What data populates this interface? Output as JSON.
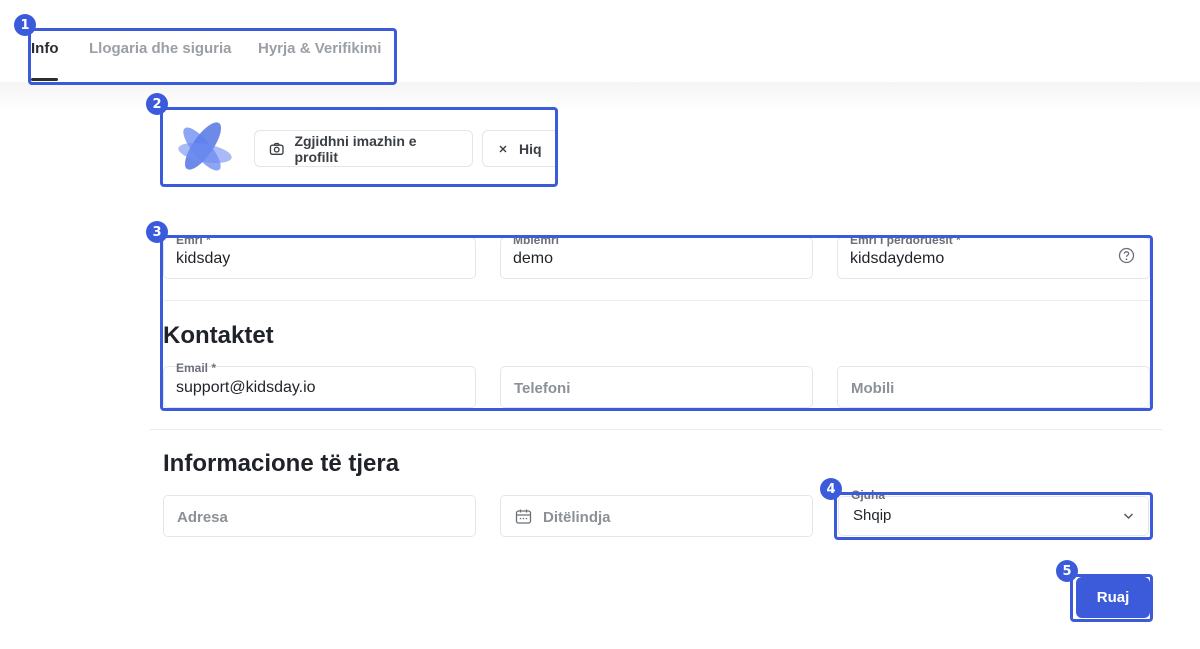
{
  "tabs": [
    {
      "label": "Info",
      "active": true
    },
    {
      "label": "Llogaria dhe siguria",
      "active": false
    },
    {
      "label": "Hyrja & Verifikimi",
      "active": false
    }
  ],
  "profile": {
    "choose_image_label": "Zgjidhni imazhin e profilit",
    "remove_label": "Hiq"
  },
  "personal": {
    "first_name": {
      "label": "Emri *",
      "value": "kidsday"
    },
    "last_name": {
      "label": "Mbiemri",
      "value": "demo"
    },
    "username": {
      "label": "Emri i përdoruesit *",
      "value": "kidsdaydemo"
    }
  },
  "contacts": {
    "title": "Kontaktet",
    "email": {
      "label": "Email *",
      "value": "support@kidsday.io"
    },
    "phone": {
      "placeholder": "Telefoni"
    },
    "mobile": {
      "placeholder": "Mobili"
    }
  },
  "other": {
    "title": "Informacione të tjera",
    "address": {
      "placeholder": "Adresa"
    },
    "birthday": {
      "placeholder": "Ditëlindja"
    },
    "language": {
      "label": "Gjuha",
      "value": "Shqip"
    }
  },
  "actions": {
    "save_label": "Ruaj"
  },
  "annotations": [
    "1",
    "2",
    "3",
    "4",
    "5"
  ],
  "colors": {
    "accent": "#3b5bdb",
    "tab_inactive": "#9aa0a6",
    "border": "#e4e6ea"
  },
  "icons": {
    "camera": "camera-icon",
    "remove": "close-icon",
    "help": "help-circle-icon",
    "calendar": "calendar-icon",
    "dropdown": "chevron-down-icon",
    "avatar": "kidsday-logo"
  }
}
